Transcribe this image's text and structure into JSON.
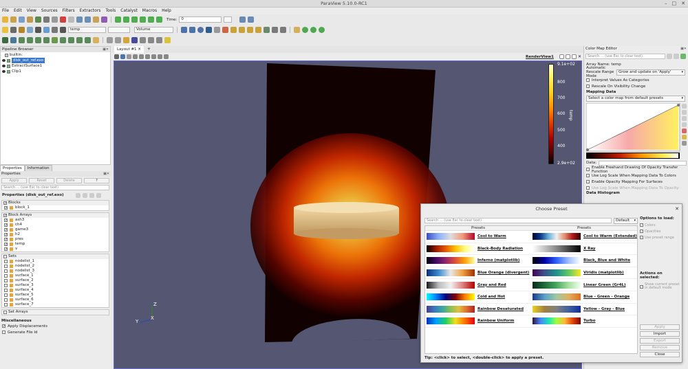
{
  "window": {
    "title": "ParaView 5.10.0-RC1",
    "controls": [
      "–",
      "□",
      "✕"
    ]
  },
  "menu": [
    "File",
    "Edit",
    "View",
    "Sources",
    "Filters",
    "Extractors",
    "Tools",
    "Catalyst",
    "Macros",
    "Help"
  ],
  "toolbar": {
    "time_label": "Time:",
    "time_value": "0",
    "array_combo": "temp",
    "blank_combo": "",
    "repr_combo": "Volume"
  },
  "pipeline": {
    "title": "Pipeline Browser",
    "items": [
      {
        "label": "builtin:",
        "selected": false
      },
      {
        "label": "disk_out_ref.exo",
        "selected": true
      },
      {
        "label": "ExtractSurface1",
        "selected": false
      },
      {
        "label": "Clip1",
        "selected": false
      }
    ]
  },
  "properties": {
    "tabs": [
      "Properties",
      "Information"
    ],
    "title": "Properties",
    "buttons": [
      "Apply",
      "Reset",
      "Delete",
      "?"
    ],
    "search_placeholder": "Search ... (use Esc to clear text)",
    "source_title": "Properties (disk_out_ref.exo)",
    "blocks_header": "Blocks",
    "blocks": [
      "block_1"
    ],
    "block_arrays_header": "Block Arrays",
    "block_arrays": [
      "ash3",
      "ch4",
      "game3",
      "h2",
      "pres",
      "temp",
      "v"
    ],
    "sets_header": "Sets",
    "sets": [
      "nodelist_1",
      "nodelist_2",
      "nodelist_3",
      "surface_1",
      "surface_2",
      "surface_3",
      "surface_4",
      "surface_5",
      "surface_6",
      "surface_7"
    ],
    "set_arrays_header": "Set Arrays",
    "misc_header": "Miscellaneous",
    "misc": [
      "Apply Displacements",
      "Generate File Id"
    ]
  },
  "layout": {
    "tab": "Layout #1",
    "view_label": "RenderView1"
  },
  "colorbar": {
    "max": "9.1e+02",
    "ticks": [
      "800",
      "700",
      "600",
      "500",
      "400"
    ],
    "min": "2.9e+02",
    "title": "temp"
  },
  "axes": {
    "z": "Z",
    "y": "Y",
    "x": "X"
  },
  "cmap_editor": {
    "title": "Color Map Editor",
    "search_placeholder": "Search ... (use Esc to clear text)",
    "array_name": "Array Name: temp",
    "auto_rescale_label": "Automatic Rescale Range Mode",
    "auto_rescale_value": "Grow and update on 'Apply'",
    "interpret_values": "Interpret Values As Categories",
    "rescale_visibility": "Rescale On Visibility Change",
    "mapping_data": "Mapping Data",
    "preset_combo": "Select a color map from default presets",
    "data_label": "Data:",
    "options": [
      "Enable Freehand Drawing Of Opacity Transfer Function",
      "Use Log Scale When Mapping Data To Colors",
      "Enable Opacity Mapping For Surfaces",
      "Use Log Scale When Mapping Data To Opacity"
    ],
    "data_histogram": "Data Histogram"
  },
  "preset_dialog": {
    "title": "Choose Preset",
    "search_placeholder": "Search ... (use Esc to clear text)",
    "filter": "Default",
    "col_header": "Presets",
    "presets": [
      [
        "Cool to Warm",
        "Cool to Warm (Extended)"
      ],
      [
        "Black-Body Radiation",
        "X Ray"
      ],
      [
        "Inferno (matplotlib)",
        "Black, Blue and White"
      ],
      [
        "Blue Orange (divergent)",
        "Viridis (matplotlib)"
      ],
      [
        "Gray and Red",
        "Linear Green (Gr4L)"
      ],
      [
        "Cold and Hot",
        "Blue - Green - Orange"
      ],
      [
        "Rainbow Desaturated",
        "Yellow - Gray - Blue"
      ],
      [
        "Rainbow Uniform",
        "Turbo"
      ]
    ],
    "options_title": "Options to load:",
    "options": [
      "Colors",
      "Opacities",
      "Use preset range"
    ],
    "actions_title": "Actions on selected:",
    "action_option": "Show current preset in default mode",
    "buttons": [
      "Apply",
      "Import",
      "Export",
      "Remove",
      "Close"
    ],
    "tip": "Tip: <click> to select, <double-click> to apply a preset."
  }
}
